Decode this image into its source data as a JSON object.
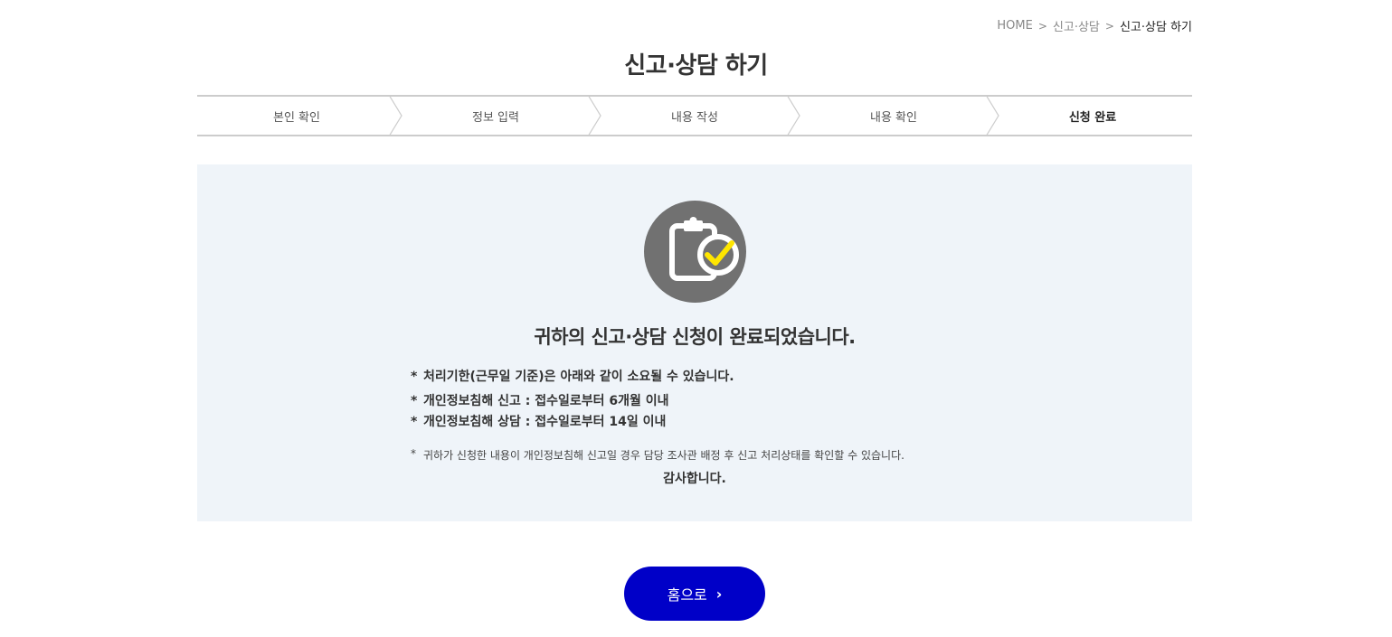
{
  "breadcrumb": {
    "items": [
      "HOME",
      "신고·상담",
      "신고·상담 하기"
    ],
    "separator": ">"
  },
  "page": {
    "title": "신고·상담 하기"
  },
  "steps": [
    {
      "label": "본인 확인",
      "active": false
    },
    {
      "label": "정보 입력",
      "active": false
    },
    {
      "label": "내용 작성",
      "active": false
    },
    {
      "label": "내용 확인",
      "active": false
    },
    {
      "label": "신청 완료",
      "active": true
    }
  ],
  "result": {
    "icon": "clipboard-check-icon",
    "message": "귀하의 신고·상담 신청이 완료되었습니다.",
    "bullet": "*",
    "notes": [
      "처리기한(근무일 기준)은 아래와 같이 소요될 수 있습니다.",
      "개인정보침해 신고 : 접수일로부터 6개월 이내",
      "개인정보침해 상담 : 접수일로부터 14일 이내"
    ],
    "footnote": "귀하가 신청한 내용이 개인정보침해 신고일 경우 담당 조사관 배정 후 신고 처리상태를 확인할 수 있습니다.",
    "thanks": "감사합니다."
  },
  "home_button": {
    "label": "홈으로",
    "chevron": "›"
  },
  "colors": {
    "accent": "#0000c8",
    "panel_bg": "#eff4f9",
    "icon_bg": "#717171",
    "check": "#ffe600"
  }
}
